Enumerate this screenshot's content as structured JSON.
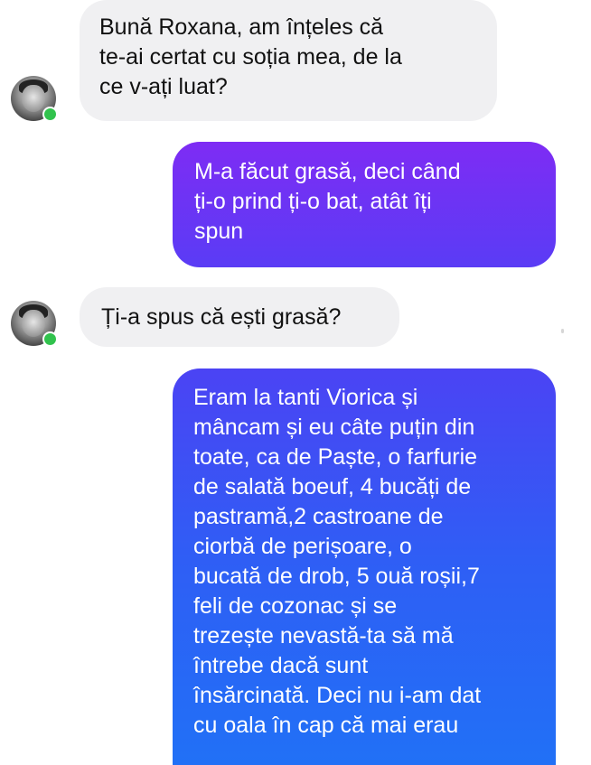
{
  "messages": [
    {
      "side": "incoming",
      "text": "Bună Roxana, am înțeles că\nte-ai certat cu soția mea, de la\nce v-ați luat?"
    },
    {
      "side": "outgoing",
      "text": "M-a făcut grasă, deci când\nți-o prind ți-o bat, atât îți\nspun"
    },
    {
      "side": "incoming",
      "text": "Ți-a spus că ești grasă?"
    },
    {
      "side": "outgoing",
      "text": "Eram la tanti Viorica și\nmâncam și eu câte puțin din\ntoate, ca de Paște,  o farfurie\nde salată boeuf, 4 bucăți de\npastramă,2 castroane de\nciorbă de perișoare, o\nbucată de drob, 5 ouă roșii,7\nfeli de cozonac și se\ntrezește nevastă-ta să mă\nîntrebe dacă sunt\nînsărcinată. Deci nu i-am dat\ncu oala în cap că mai erau"
    }
  ],
  "colors": {
    "incoming_bubble": "#f0f0f2",
    "outgoing_gradient_top": "#7a2cf5",
    "outgoing_gradient_bottom": "#1f6ff6",
    "online_indicator": "#31c24d"
  },
  "icons": {
    "avatar": "profile-photo",
    "presence": "online-dot"
  }
}
